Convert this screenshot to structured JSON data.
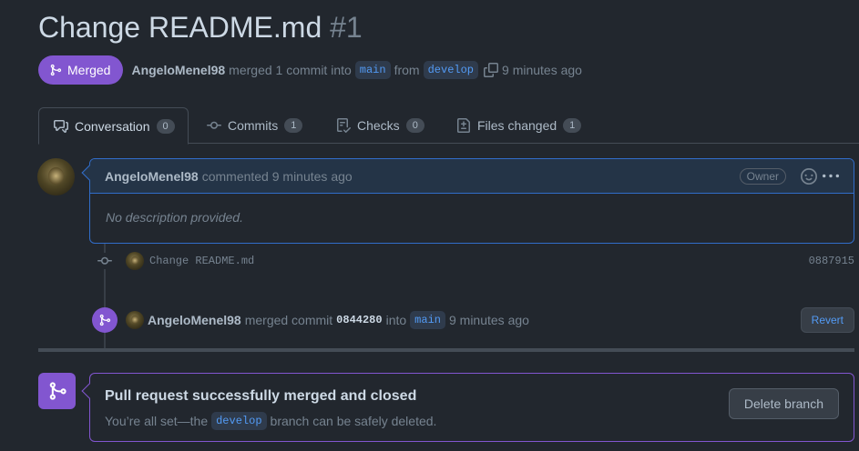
{
  "pr": {
    "title": "Change README.md",
    "number": "#1"
  },
  "meta": {
    "state": "Merged",
    "author": "AngeloMenel98",
    "text_merged": "merged 1 commit into",
    "base_branch": "main",
    "text_from": "from",
    "head_branch": "develop",
    "time": "9 minutes ago"
  },
  "tabs": [
    {
      "label": "Conversation",
      "count": "0",
      "icon": "comment-discussion-icon"
    },
    {
      "label": "Commits",
      "count": "1",
      "icon": "git-commit-icon"
    },
    {
      "label": "Checks",
      "count": "0",
      "icon": "checklist-icon"
    },
    {
      "label": "Files changed",
      "count": "1",
      "icon": "file-diff-icon"
    }
  ],
  "comment": {
    "author": "AngeloMenel98",
    "action": "commented 9 minutes ago",
    "badge": "Owner",
    "body": "No description provided."
  },
  "commit": {
    "message": "Change README.md",
    "sha": "0887915"
  },
  "merge_event": {
    "author": "AngeloMenel98",
    "text_merged": "merged commit",
    "sha": "0844280",
    "text_into": "into",
    "branch": "main",
    "time": "9 minutes ago",
    "revert_label": "Revert"
  },
  "merged_box": {
    "title": "Pull request successfully merged and closed",
    "desc_prefix": "You’re all set—the",
    "branch": "develop",
    "desc_suffix": "branch can be safely deleted.",
    "delete_label": "Delete branch"
  },
  "colors": {
    "background": "#22272e",
    "merged_purple": "#8256d0",
    "accent_blue": "#539bf5",
    "comment_border": "#316dca"
  }
}
